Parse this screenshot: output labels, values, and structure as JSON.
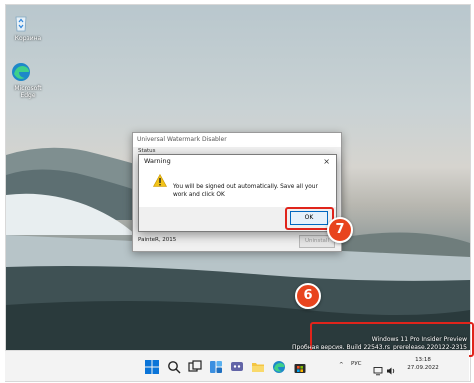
{
  "desktop": {
    "icons": [
      {
        "label": "Корзина",
        "icon": "recycle-bin-icon"
      },
      {
        "label": "Microsoft Edge",
        "icon": "edge-icon"
      }
    ]
  },
  "main_window": {
    "title": "Universal Watermark Disabler",
    "group_label": "Status",
    "author": "PainteR, 2015",
    "uninstall_label": "Uninstall"
  },
  "warning_dialog": {
    "title": "Warning",
    "message": "You will be signed out automatically. Save all your work and click OK",
    "ok_label": "OK",
    "close_glyph": "×"
  },
  "annotations": {
    "step_ok": "7",
    "step_watermark": "6",
    "highlight_color": "#e0241b",
    "badge_color": "#e8441e"
  },
  "watermark": {
    "line1": "Windows 11 Pro Insider Preview",
    "line2": "Пробная версия. Build 22543.rs_prerelease.220122-2315"
  },
  "taskbar": {
    "icons": [
      "windows-start-icon",
      "search-icon",
      "task-view-icon",
      "widgets-icon",
      "chat-icon",
      "file-explorer-icon",
      "edge-icon",
      "store-icon"
    ],
    "tray_language": "РУС",
    "time": "13:18",
    "date": "27.09.2022",
    "tray_chevron": "^"
  }
}
